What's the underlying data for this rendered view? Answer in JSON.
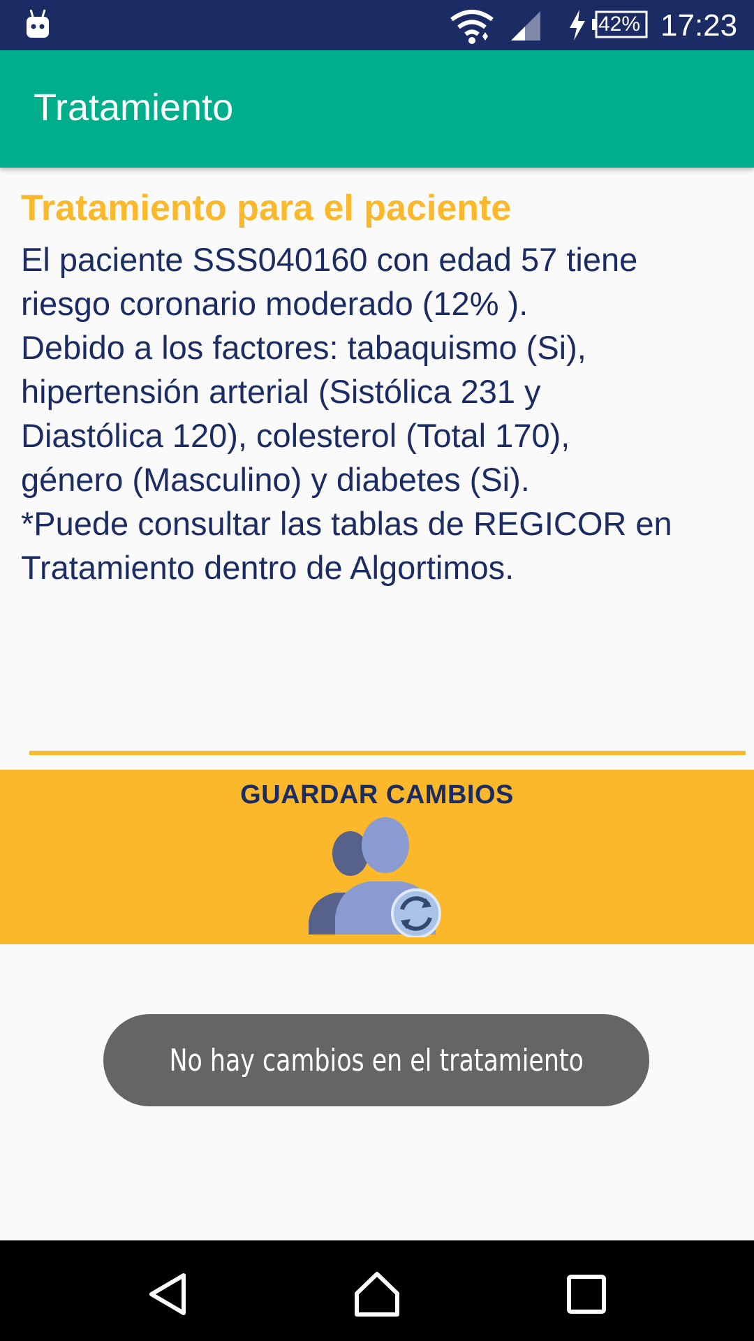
{
  "status_bar": {
    "battery_percent": "42%",
    "time": "17:23",
    "icons": [
      "android-debug-icon",
      "wifi-icon",
      "signal-icon",
      "charging-icon",
      "battery-icon"
    ]
  },
  "app_bar": {
    "title": "Tratamiento"
  },
  "content": {
    "section_title": "Tratamiento para el paciente",
    "lines": [
      "El paciente SSS040160 con edad 57 tiene",
      "riesgo coronario moderado (12% ).",
      "Debido a los factores: tabaquismo (Si),",
      "hipertensión arterial (Sistólica 231 y",
      "Diastólica 120), colesterol (Total 170),",
      "género (Masculino) y diabetes (Si).",
      "*Puede consultar las tablas de REGICOR en",
      "Tratamiento dentro de Algortimos."
    ]
  },
  "save_panel": {
    "label": "GUARDAR CAMBIOS",
    "icon": "users-sync-icon"
  },
  "toast": {
    "message": "No hay cambios en el tratamiento"
  },
  "colors": {
    "status_bar": "#1b2b63",
    "app_bar": "#00ae8c",
    "accent": "#fbb82a",
    "text_primary": "#1b2b63",
    "toast_bg": "#656565"
  }
}
